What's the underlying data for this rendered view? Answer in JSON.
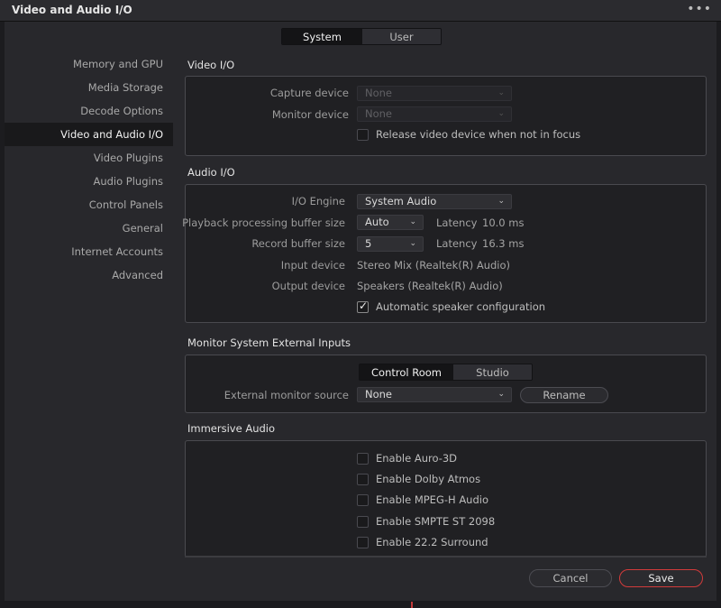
{
  "window": {
    "title": "Video and Audio I/O",
    "menu_glyph": "•••"
  },
  "tabs": [
    {
      "label": "System",
      "active": true
    },
    {
      "label": "User",
      "active": false
    }
  ],
  "sidebar": {
    "items": [
      {
        "label": "Memory and GPU"
      },
      {
        "label": "Media Storage"
      },
      {
        "label": "Decode Options"
      },
      {
        "label": "Video and Audio I/O",
        "active": true
      },
      {
        "label": "Video Plugins"
      },
      {
        "label": "Audio Plugins"
      },
      {
        "label": "Control Panels"
      },
      {
        "label": "General"
      },
      {
        "label": "Internet Accounts"
      },
      {
        "label": "Advanced"
      }
    ]
  },
  "video_io": {
    "title": "Video I/O",
    "capture_label": "Capture device",
    "capture_value": "None",
    "monitor_label": "Monitor device",
    "monitor_value": "None",
    "release_label": "Release video device when not in focus",
    "release_checked": false
  },
  "audio_io": {
    "title": "Audio I/O",
    "engine_label": "I/O Engine",
    "engine_value": "System Audio",
    "playback_label": "Playback processing buffer size",
    "playback_value": "Auto",
    "playback_latency_label": "Latency",
    "playback_latency_value": "10.0 ms",
    "record_label": "Record buffer size",
    "record_value": "5",
    "record_latency_label": "Latency",
    "record_latency_value": "16.3 ms",
    "input_label": "Input device",
    "input_value": "Stereo Mix (Realtek(R) Audio)",
    "output_label": "Output device",
    "output_value": "Speakers (Realtek(R) Audio)",
    "auto_speaker_label": "Automatic speaker configuration",
    "auto_speaker_checked": true
  },
  "monitor_inputs": {
    "title": "Monitor System External Inputs",
    "tabs": [
      {
        "label": "Control Room",
        "active": true
      },
      {
        "label": "Studio",
        "active": false
      }
    ],
    "source_label": "External monitor source",
    "source_value": "None",
    "rename_label": "Rename"
  },
  "immersive": {
    "title": "Immersive Audio",
    "options": [
      {
        "label": "Enable Auro-3D",
        "checked": false
      },
      {
        "label": "Enable Dolby Atmos",
        "checked": false
      },
      {
        "label": "Enable MPEG-H Audio",
        "checked": false
      },
      {
        "label": "Enable SMPTE ST 2098",
        "checked": false
      },
      {
        "label": "Enable 22.2 Surround",
        "checked": false
      }
    ]
  },
  "footer": {
    "cancel_label": "Cancel",
    "save_label": "Save"
  },
  "colors": {
    "accent_save": "#d23b3b",
    "panel_border": "#4a4a4f",
    "background": "#28282c"
  },
  "icons": {
    "dropdown": "chevron-down-icon",
    "check": "check-icon",
    "menu": "more-icon"
  }
}
